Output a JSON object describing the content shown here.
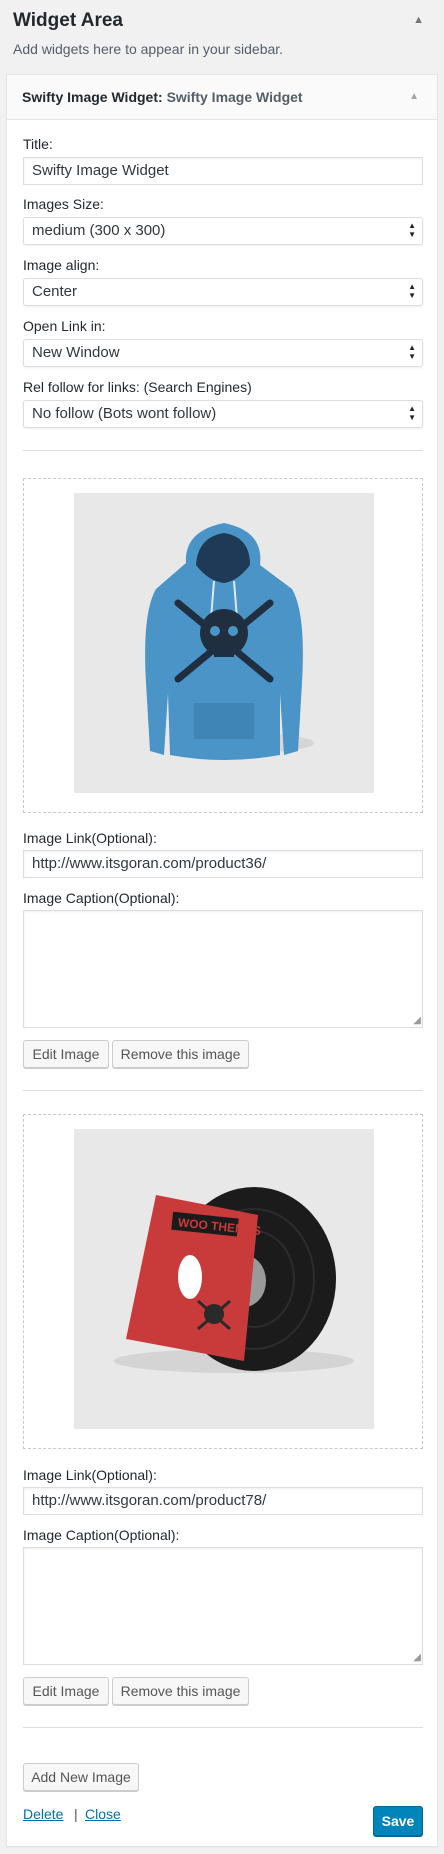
{
  "area": {
    "title": "Widget Area",
    "description": "Add widgets here to appear in your sidebar.",
    "toggle_icon": "▲"
  },
  "widget": {
    "name": "Swifty Image Widget:",
    "instance_title": "Swifty Image Widget",
    "toggle_icon": "▲"
  },
  "form": {
    "title_label": "Title:",
    "title_value": "Swifty Image Widget",
    "size_label": "Images Size:",
    "size_value": "medium (300 x 300)",
    "align_label": "Image align:",
    "align_value": "Center",
    "open_label": "Open Link in:",
    "open_value": "New Window",
    "rel_label": "Rel follow for links: (Search Engines)",
    "rel_value": "No follow (Bots wont follow)"
  },
  "images": [
    {
      "link_label": "Image Link(Optional):",
      "link_value": "http://www.itsgoran.com/product36/",
      "caption_label": "Image Caption(Optional):",
      "caption_value": "",
      "edit_label": "Edit Image",
      "remove_label": "Remove this image"
    },
    {
      "link_label": "Image Link(Optional):",
      "link_value": "http://www.itsgoran.com/product78/",
      "caption_label": "Image Caption(Optional):",
      "caption_value": "",
      "edit_label": "Edit Image",
      "remove_label": "Remove this image",
      "logo_text": "WOO THEMES"
    }
  ],
  "actions": {
    "add_label": "Add New Image",
    "delete_label": "Delete",
    "separator": "|",
    "close_label": "Close",
    "save_label": "Save"
  },
  "colors": {
    "accent": "#0085ba",
    "link": "#0073aa",
    "hoodie": "#4a94c7",
    "sleeve": "#c93b3b"
  }
}
